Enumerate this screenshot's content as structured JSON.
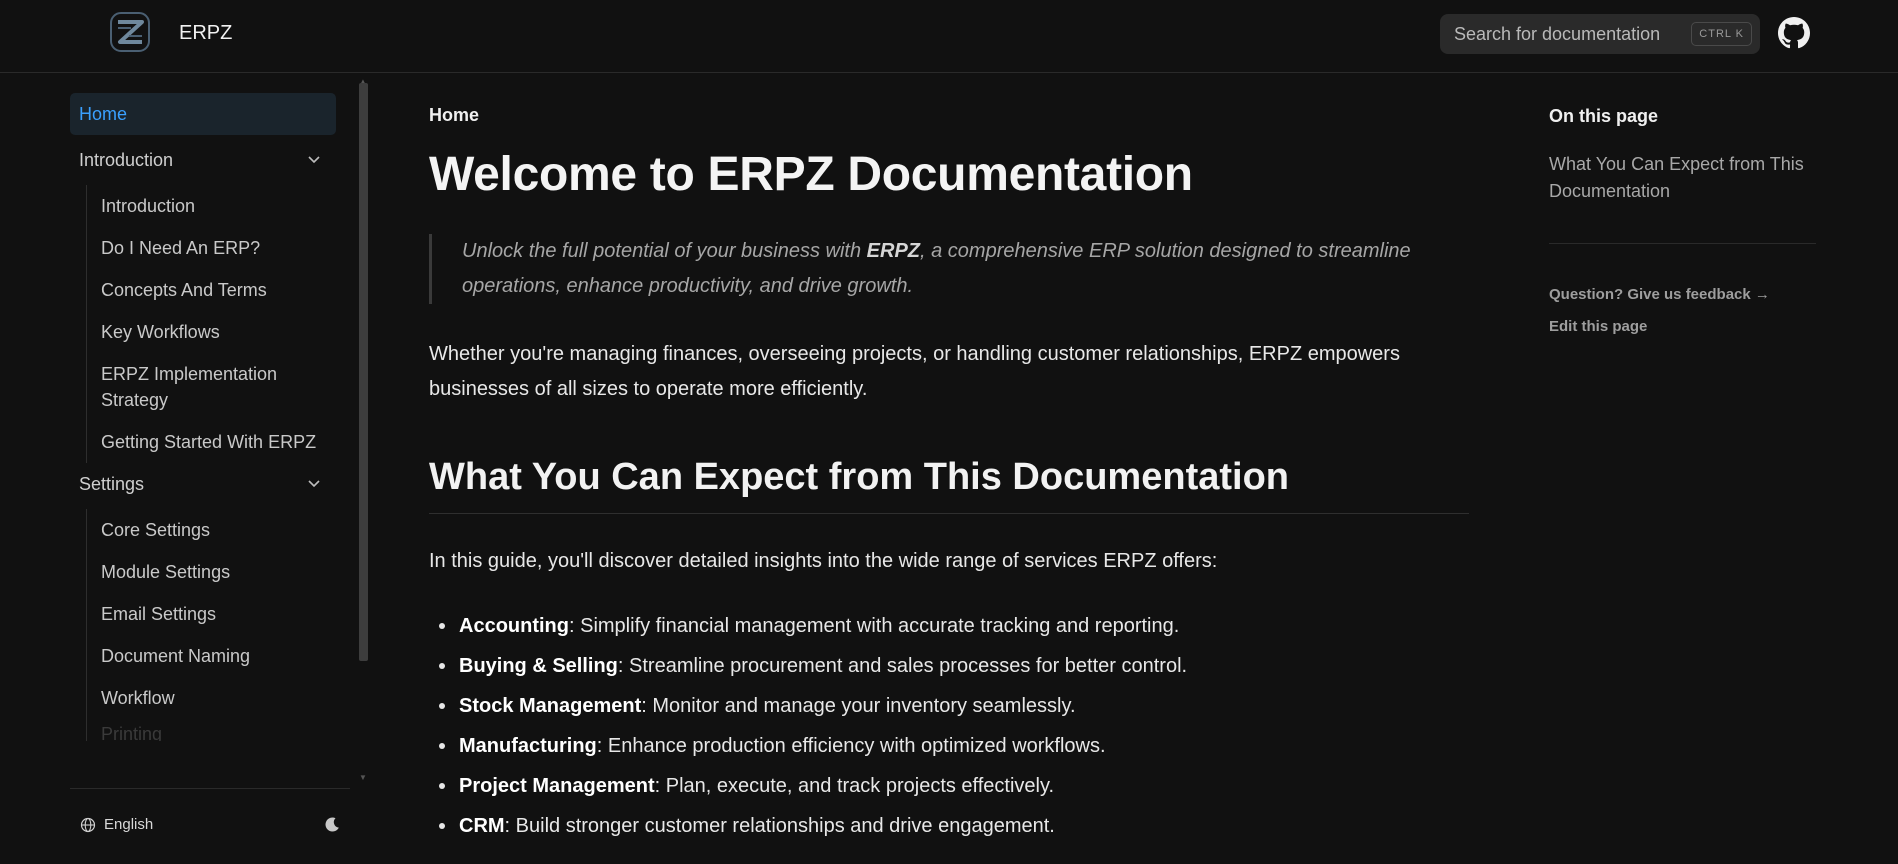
{
  "header": {
    "title": "ERPZ",
    "search_placeholder": "Search for documentation",
    "search_shortcut": "CTRL K",
    "logo_icon": "erpz-logo",
    "github_icon": "github-icon"
  },
  "sidebar": {
    "items": [
      {
        "label": "Home",
        "active": true
      },
      {
        "label": "Introduction",
        "expanded": true,
        "children": [
          "Introduction",
          "Do I Need An ERP?",
          "Concepts And Terms",
          "Key Workflows",
          "ERPZ Implementation Strategy",
          "Getting Started With ERPZ"
        ]
      },
      {
        "label": "Settings",
        "expanded": true,
        "children": [
          "Core Settings",
          "Module Settings",
          "Email Settings",
          "Document Naming",
          "Workflow",
          "Printing"
        ]
      }
    ],
    "footer": {
      "language": "English",
      "theme_icon": "moon-icon"
    }
  },
  "main": {
    "breadcrumb": "Home",
    "title": "Welcome to ERPZ Documentation",
    "quote": {
      "before": "Unlock the full potential of your business with ",
      "bold": "ERPZ",
      "after": ", a comprehensive ERP solution designed to streamline operations, enhance productivity, and drive growth."
    },
    "intro": "Whether you're managing finances, overseeing projects, or handling customer relationships, ERPZ empowers businesses of all sizes to operate more efficiently.",
    "section_title": "What You Can Expect from This Documentation",
    "section_intro": "In this guide, you'll discover detailed insights into the wide range of services ERPZ offers:",
    "features": [
      {
        "name": "Accounting",
        "desc": ": Simplify financial management with accurate tracking and reporting."
      },
      {
        "name": "Buying & Selling",
        "desc": ": Streamline procurement and sales processes for better control."
      },
      {
        "name": "Stock Management",
        "desc": ": Monitor and manage your inventory seamlessly."
      },
      {
        "name": "Manufacturing",
        "desc": ": Enhance production efficiency with optimized workflows."
      },
      {
        "name": "Project Management",
        "desc": ": Plan, execute, and track projects effectively."
      },
      {
        "name": "CRM",
        "desc": ": Build stronger customer relationships and drive engagement."
      }
    ]
  },
  "toc": {
    "title": "On this page",
    "link": "What You Can Expect from This Documentation",
    "feedback": "Question? Give us feedback →",
    "edit": "Edit this page"
  },
  "colors": {
    "background": "#111111",
    "accent": "#3aa0ff",
    "active_bg": "#1a242c"
  }
}
